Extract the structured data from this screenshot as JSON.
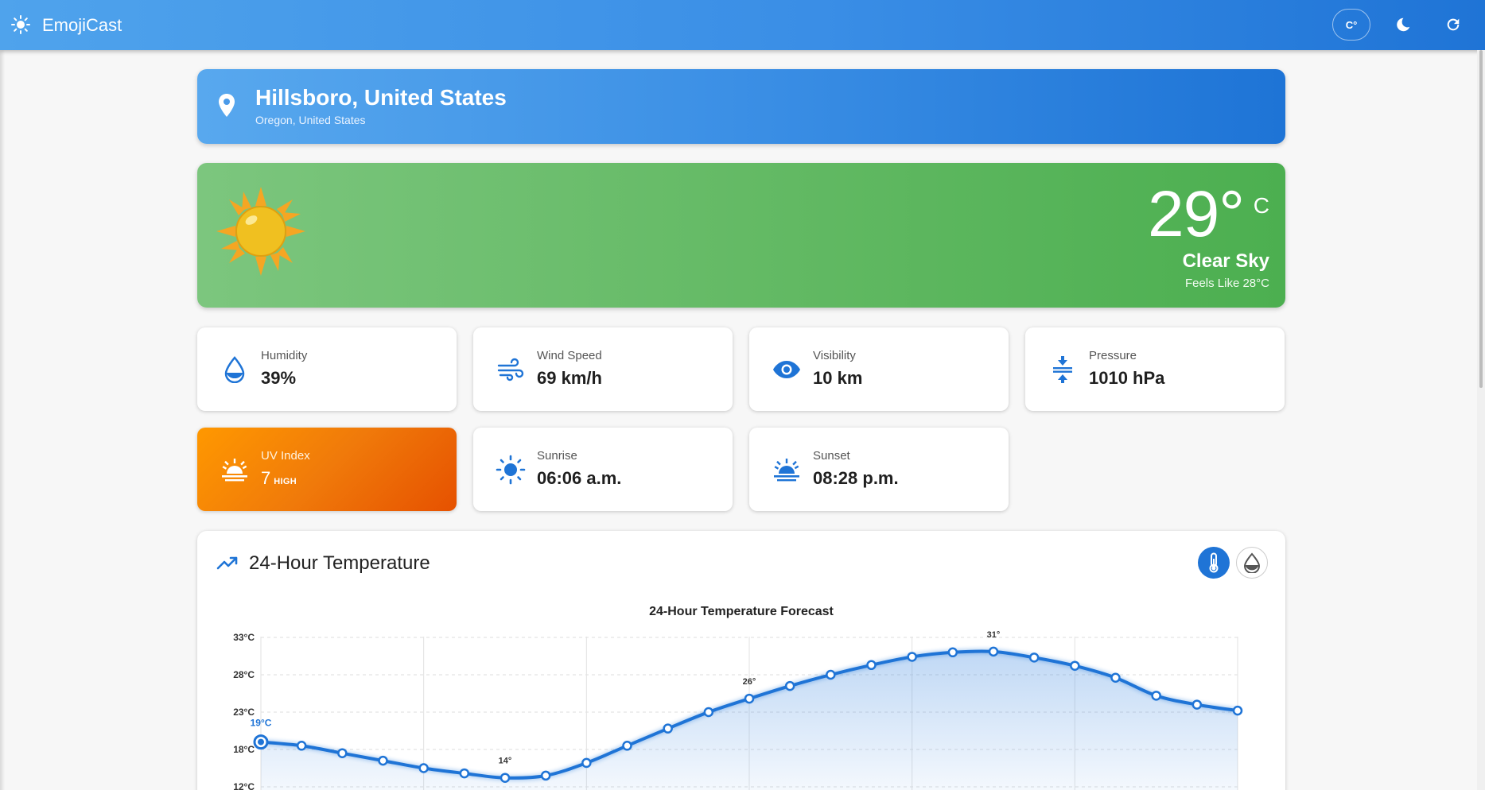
{
  "app": {
    "title": "EmojiCast",
    "unit_toggle": "C°",
    "logo_icon": "sun-icon",
    "theme_icon": "moon-icon",
    "refresh_icon": "refresh-icon"
  },
  "location": {
    "city": "Hillsboro, United States",
    "region": "Oregon, United States",
    "icon": "location-pin-icon"
  },
  "current": {
    "temperature": "29°",
    "unit": "C",
    "condition": "Clear Sky",
    "feels_like": "Feels Like 28°C",
    "emoji": "sun-emoji",
    "color": "#4caf50"
  },
  "stats": [
    {
      "label": "Humidity",
      "value": "39%",
      "icon": "water-drop-icon"
    },
    {
      "label": "Wind Speed",
      "value": "69 km/h",
      "icon": "wind-icon"
    },
    {
      "label": "Visibility",
      "value": "10 km",
      "icon": "eye-icon"
    },
    {
      "label": "Pressure",
      "value": "1010 hPa",
      "icon": "compress-icon"
    },
    {
      "label": "UV Index",
      "value": "7",
      "level": "HIGH",
      "icon": "sunrise-icon",
      "color": "#f57c00"
    },
    {
      "label": "Sunrise",
      "value": "06:06 a.m.",
      "icon": "sun-icon"
    },
    {
      "label": "Sunset",
      "value": "08:28 p.m.",
      "icon": "sunset-icon"
    }
  ],
  "chart_section": {
    "heading": "24-Hour Temperature",
    "icon": "trending-up-icon",
    "toggles": [
      {
        "icon": "thermometer-icon",
        "active": true
      },
      {
        "icon": "humidity-icon",
        "active": false
      }
    ]
  },
  "chart_data": {
    "type": "line",
    "title": "24-Hour Temperature Forecast",
    "xlabel": "",
    "ylabel": "",
    "y_ticks": [
      "33°C",
      "28°C",
      "23°C",
      "18°C",
      "12°C"
    ],
    "y_tick_values": [
      33,
      28,
      23,
      18,
      13
    ],
    "ylim": [
      13,
      33
    ],
    "series": [
      {
        "values": [
          19,
          18.5,
          17.5,
          16.5,
          15.5,
          14.8,
          14.2,
          14.5,
          16.2,
          18.5,
          20.8,
          23,
          24.8,
          26.5,
          28,
          29.3,
          30.4,
          31,
          31.1,
          30.3,
          29.2,
          27.6,
          25.2,
          24,
          23.2
        ]
      }
    ],
    "data_labels": [
      {
        "index": 0,
        "text": "19°C"
      },
      {
        "index": 6,
        "text": "14°"
      },
      {
        "index": 12,
        "text": "26°"
      },
      {
        "index": 18,
        "text": "31°"
      }
    ],
    "color": "#1f74d6",
    "grid": true
  }
}
